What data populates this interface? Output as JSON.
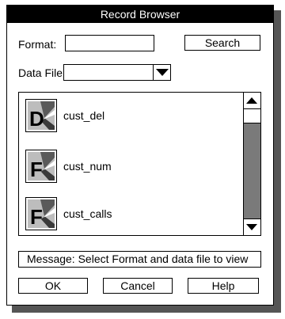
{
  "window": {
    "title": "Record Browser"
  },
  "format": {
    "label": "Format:",
    "value": ""
  },
  "search_button": {
    "label": "Search"
  },
  "data_file": {
    "label": "Data File:",
    "value": ""
  },
  "records": [
    {
      "name": "cust_del",
      "icon": "delimited-format-icon",
      "letter": "D"
    },
    {
      "name": "cust_num",
      "icon": "fixed-format-icon",
      "letter": "F"
    },
    {
      "name": "cust_calls",
      "icon": "fixed-format-icon",
      "letter": "F"
    }
  ],
  "message": {
    "text": "Message: Select Format and data file to view"
  },
  "buttons": {
    "ok": "OK",
    "cancel": "Cancel",
    "help": "Help"
  },
  "colors": {
    "titlebar": "#000000",
    "scroll_track": "#7a7a7a",
    "window_shadow": "#555555"
  }
}
